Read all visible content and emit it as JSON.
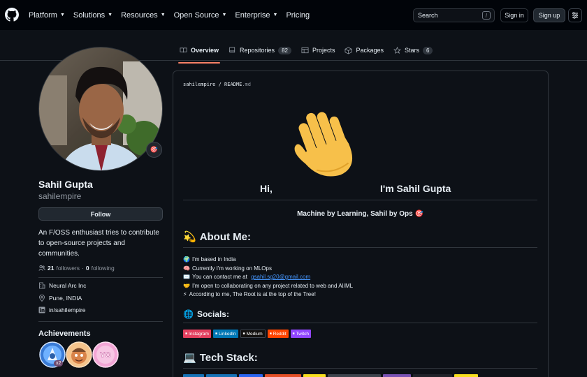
{
  "header": {
    "nav": [
      "Platform",
      "Solutions",
      "Resources",
      "Open Source",
      "Enterprise",
      "Pricing"
    ],
    "nav_has_caret": [
      true,
      true,
      true,
      true,
      true,
      false
    ],
    "search_label": "Search",
    "search_shortcut": "/",
    "signin_label": "Sign in",
    "signup_label": "Sign up"
  },
  "tabs": [
    {
      "label": "Overview",
      "icon": "book-icon",
      "active": true,
      "count": ""
    },
    {
      "label": "Repositories",
      "icon": "repo-icon",
      "active": false,
      "count": "82"
    },
    {
      "label": "Projects",
      "icon": "table-icon",
      "active": false,
      "count": ""
    },
    {
      "label": "Packages",
      "icon": "package-icon",
      "active": false,
      "count": ""
    },
    {
      "label": "Stars",
      "icon": "star-icon",
      "active": false,
      "count": "6"
    }
  ],
  "profile": {
    "fullname": "Sahil Gupta",
    "username": "sahilempire",
    "follow_label": "Follow",
    "bio": "An F/OSS enthusiast tries to contribute to open-source projects and communities.",
    "followers_count": "21",
    "followers_label": "followers",
    "separator": "·",
    "following_count": "0",
    "following_label": "following",
    "company": "Neural Arc Inc",
    "location": "Pune, INDIA",
    "linkedin": "in/sahilempire",
    "achievements_title": "Achievements",
    "achievement_multiplier": "x2"
  },
  "readme": {
    "path_user": "sahilempire",
    "path_sep": " / ",
    "path_file": "README",
    "path_ext": ".md",
    "hi": "Hi,",
    "intro": "I'm Sahil Gupta",
    "tagline": "Machine by Learning, Sahil by Ops 🎯",
    "about_title": "About Me:",
    "about_lines": [
      {
        "emoji": "🌍",
        "text": "I'm based in India",
        "link": ""
      },
      {
        "emoji": "🧠",
        "text": "Currently I'm working on MLOps",
        "link": ""
      },
      {
        "emoji": "✉️",
        "text": "You can contact me at ",
        "link": "gsahil.sg20@gmail.com"
      },
      {
        "emoji": "🤝",
        "text": "I'm open to collaborating on any project related to web and AI/ML",
        "link": ""
      },
      {
        "emoji": "⚡",
        "text": "According to me, The Root is at the top of the Tree!",
        "link": ""
      }
    ],
    "socials_title": "Socials:",
    "socials": [
      {
        "label": "Instagram",
        "color": "#E4405F"
      },
      {
        "label": "LinkedIn",
        "color": "#0077B5"
      },
      {
        "label": "Medium",
        "color": "#12100E"
      },
      {
        "label": "Reddit",
        "color": "#FF4500"
      },
      {
        "label": "Twitch",
        "color": "#9146FF"
      }
    ],
    "tech_title": "Tech Stack:"
  },
  "colors": {
    "accent_tab": "#f78166",
    "link": "#4493f8"
  }
}
